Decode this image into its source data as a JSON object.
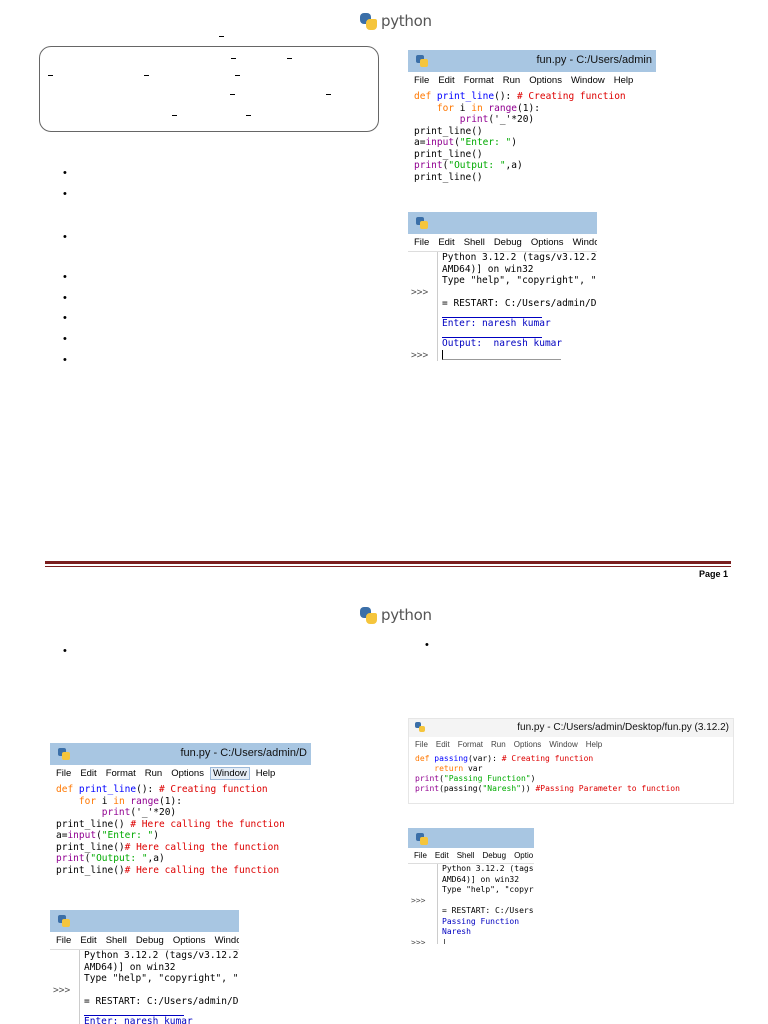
{
  "page1": {
    "logo_text": "python",
    "bullets_left_count": 9,
    "editor": {
      "title": "fun.py - C:/Users/admin",
      "menu": [
        "File",
        "Edit",
        "Format",
        "Run",
        "Options",
        "Window",
        "Help"
      ],
      "lines": [
        [
          {
            "t": "def ",
            "c": "kw"
          },
          {
            "t": "print_line",
            "c": "fn"
          },
          {
            "t": "(): ",
            "c": ""
          },
          {
            "t": "# Creating function",
            "c": "cm"
          }
        ],
        [
          {
            "t": "    ",
            "c": ""
          },
          {
            "t": "for",
            "c": "kw"
          },
          {
            "t": " i ",
            "c": ""
          },
          {
            "t": "in",
            "c": "kw"
          },
          {
            "t": " ",
            "c": ""
          },
          {
            "t": "range",
            "c": "bi"
          },
          {
            "t": "(1):",
            "c": ""
          }
        ],
        [
          {
            "t": "        ",
            "c": ""
          },
          {
            "t": "print",
            "c": "bi"
          },
          {
            "t": "('_'*20)",
            "c": ""
          }
        ],
        [
          {
            "t": "print_line()",
            "c": ""
          }
        ],
        [
          {
            "t": "a=",
            "c": ""
          },
          {
            "t": "input",
            "c": "bi"
          },
          {
            "t": "(",
            "c": ""
          },
          {
            "t": "\"Enter: \"",
            "c": "st"
          },
          {
            "t": ")",
            "c": ""
          }
        ],
        [
          {
            "t": "print_line()",
            "c": ""
          }
        ],
        [
          {
            "t": "print",
            "c": "bi"
          },
          {
            "t": "(",
            "c": ""
          },
          {
            "t": "\"Output: \"",
            "c": "st"
          },
          {
            "t": ",a)",
            "c": ""
          }
        ],
        [
          {
            "t": "print_line()",
            "c": ""
          }
        ]
      ]
    },
    "shell": {
      "menu": [
        "File",
        "Edit",
        "Shell",
        "Debug",
        "Options",
        "Window"
      ],
      "lines": [
        {
          "p": "",
          "t": "Python 3.12.2 (tags/v3.12.2",
          "c": ""
        },
        {
          "p": "",
          "t": "AMD64)] on win32",
          "c": ""
        },
        {
          "p": "",
          "t": "Type \"help\", \"copyright\", \"",
          "c": ""
        },
        {
          "p": ">>>",
          "t": "",
          "c": ""
        },
        {
          "p": "",
          "t": "= RESTART: C:/Users/admin/D",
          "c": ""
        },
        {
          "p": "",
          "t": "",
          "c": "rule"
        },
        {
          "p": "",
          "t": "Enter: naresh kumar",
          "c": "out"
        },
        {
          "p": "",
          "t": "",
          "c": "rule"
        },
        {
          "p": "",
          "t": "Output:  naresh kumar",
          "c": "out"
        },
        {
          "p": "",
          "t": "",
          "c": ""
        },
        {
          "p": ">>>",
          "t": "",
          "c": "cursor"
        }
      ]
    },
    "footer": "Page 1"
  },
  "page2": {
    "logo_text": "python",
    "editor_small": {
      "title": "fun.py - C:/Users/admin/Desktop/fun.py (3.12.2)",
      "menu": [
        "File",
        "Edit",
        "Format",
        "Run",
        "Options",
        "Window",
        "Help"
      ],
      "lines": [
        [
          {
            "t": "def ",
            "c": "kw"
          },
          {
            "t": "passing",
            "c": "fn"
          },
          {
            "t": "(var): ",
            "c": ""
          },
          {
            "t": "# Creating function",
            "c": "cm"
          }
        ],
        [
          {
            "t": "    ",
            "c": ""
          },
          {
            "t": "return",
            "c": "kw"
          },
          {
            "t": " var",
            "c": ""
          }
        ],
        [
          {
            "t": "print",
            "c": "bi"
          },
          {
            "t": "(",
            "c": ""
          },
          {
            "t": "\"Passing Function\"",
            "c": "st"
          },
          {
            "t": ")",
            "c": ""
          }
        ],
        [
          {
            "t": "print",
            "c": "bi"
          },
          {
            "t": "(passing(",
            "c": ""
          },
          {
            "t": "\"Naresh\"",
            "c": "st"
          },
          {
            "t": ")) ",
            "c": ""
          },
          {
            "t": "#Passing Parameter to function",
            "c": "cm"
          }
        ]
      ]
    },
    "shell_small": {
      "menu": [
        "File",
        "Edit",
        "Shell",
        "Debug",
        "Optio"
      ],
      "lines": [
        {
          "p": "",
          "t": "Python 3.12.2 (tags",
          "c": ""
        },
        {
          "p": "",
          "t": "AMD64)] on win32",
          "c": ""
        },
        {
          "p": "",
          "t": "Type \"help\", \"copyr",
          "c": ""
        },
        {
          "p": ">>>",
          "t": "",
          "c": ""
        },
        {
          "p": "",
          "t": "= RESTART: C:/Users",
          "c": ""
        },
        {
          "p": "",
          "t": "Passing Function",
          "c": "out"
        },
        {
          "p": "",
          "t": "Naresh",
          "c": "out"
        },
        {
          "p": ">>>",
          "t": "|",
          "c": ""
        }
      ]
    },
    "editor_left": {
      "title": "fun.py - C:/Users/admin/D",
      "menu": [
        "File",
        "Edit",
        "Format",
        "Run",
        "Options",
        "Window",
        "Help"
      ],
      "active_menu": "Window",
      "lines": [
        [
          {
            "t": "def ",
            "c": "kw"
          },
          {
            "t": "print_line",
            "c": "fn"
          },
          {
            "t": "(): ",
            "c": ""
          },
          {
            "t": "# Creating function",
            "c": "cm"
          }
        ],
        [
          {
            "t": "    ",
            "c": ""
          },
          {
            "t": "for",
            "c": "kw"
          },
          {
            "t": " i ",
            "c": ""
          },
          {
            "t": "in",
            "c": "kw"
          },
          {
            "t": " ",
            "c": ""
          },
          {
            "t": "range",
            "c": "bi"
          },
          {
            "t": "(1):",
            "c": ""
          }
        ],
        [
          {
            "t": "        ",
            "c": ""
          },
          {
            "t": "print",
            "c": "bi"
          },
          {
            "t": "('_'*20)",
            "c": ""
          }
        ],
        [
          {
            "t": "print_line() ",
            "c": ""
          },
          {
            "t": "# Here calling the function",
            "c": "cm"
          }
        ],
        [
          {
            "t": "a=",
            "c": ""
          },
          {
            "t": "input",
            "c": "bi"
          },
          {
            "t": "(",
            "c": ""
          },
          {
            "t": "\"Enter: \"",
            "c": "st"
          },
          {
            "t": ")",
            "c": ""
          }
        ],
        [
          {
            "t": "print_line()",
            "c": ""
          },
          {
            "t": "# Here calling the function",
            "c": "cm"
          }
        ],
        [
          {
            "t": "print",
            "c": "bi"
          },
          {
            "t": "(",
            "c": ""
          },
          {
            "t": "\"Output: \"",
            "c": "st"
          },
          {
            "t": ",a)",
            "c": ""
          }
        ],
        [
          {
            "t": "print_line()",
            "c": ""
          },
          {
            "t": "# Here calling the function",
            "c": "cm"
          }
        ]
      ]
    },
    "shell_left": {
      "menu": [
        "File",
        "Edit",
        "Shell",
        "Debug",
        "Options",
        "Windo"
      ],
      "lines": [
        {
          "p": "",
          "t": "Python 3.12.2 (tags/v3.12.2",
          "c": ""
        },
        {
          "p": "",
          "t": "AMD64)] on win32",
          "c": ""
        },
        {
          "p": "",
          "t": "Type \"help\", \"copyright\", \"",
          "c": ""
        },
        {
          "p": ">>>",
          "t": "",
          "c": ""
        },
        {
          "p": "",
          "t": "= RESTART: C:/Users/admin/D",
          "c": ""
        },
        {
          "p": "",
          "t": "",
          "c": "rule"
        },
        {
          "p": "",
          "t": "Enter: naresh kumar",
          "c": "out"
        }
      ]
    }
  }
}
